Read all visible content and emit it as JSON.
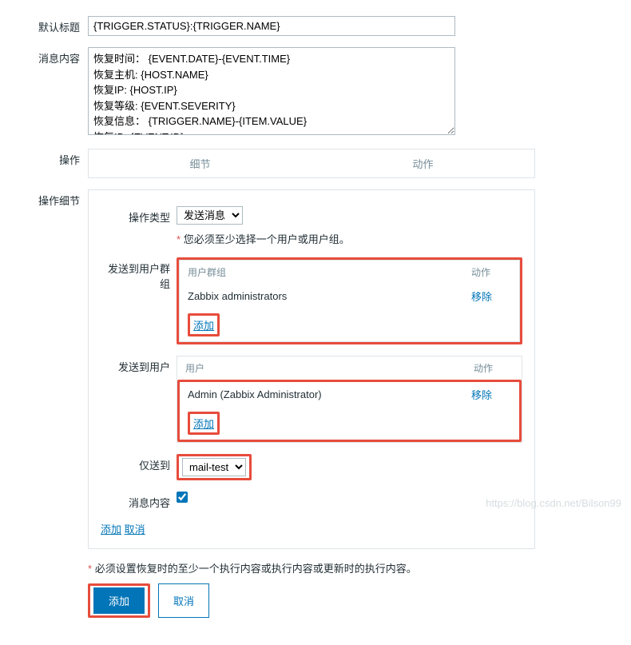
{
  "labels": {
    "default_title": "默认标题",
    "message_content": "消息内容",
    "operation": "操作",
    "operation_details": "操作细节",
    "operation_type": "操作类型",
    "send_to_user_groups": "发送到用户群组",
    "send_to_users": "发送到用户",
    "only_send_to": "仅送到",
    "msg_content_cb": "消息内容"
  },
  "default_title_value": "{TRIGGER.STATUS}:{TRIGGER.NAME}",
  "message_content_value": "恢复时间： {EVENT.DATE}-{EVENT.TIME}\n恢复主机: {HOST.NAME}\n恢复IP: {HOST.IP}\n恢复等级: {EVENT.SEVERITY}\n恢复信息： {TRIGGER.NAME}-{ITEM.VALUE}\n恢复ID: {EVENT.ID}",
  "tabs": {
    "details": "细节",
    "action": "动作"
  },
  "operation_type_selected": "发送消息",
  "hint_select_user": "您必须至少选择一个用户或用户组。",
  "user_groups_table": {
    "header_group": "用户群组",
    "header_action": "动作",
    "row1": "Zabbix administrators",
    "remove": "移除",
    "add": "添加"
  },
  "users_table": {
    "header_user": "用户",
    "header_action": "动作",
    "row1": "Admin (Zabbix Administrator)",
    "remove": "移除",
    "add": "添加"
  },
  "only_send_to_selected": "mail-test",
  "inline": {
    "add": "添加",
    "cancel": "取消"
  },
  "footer_warning": "必须设置恢复时的至少一个执行内容或执行内容或更新时的执行内容。",
  "buttons": {
    "add": "添加",
    "cancel": "取消"
  },
  "watermark": "https://blog.csdn.net/Bilson99"
}
